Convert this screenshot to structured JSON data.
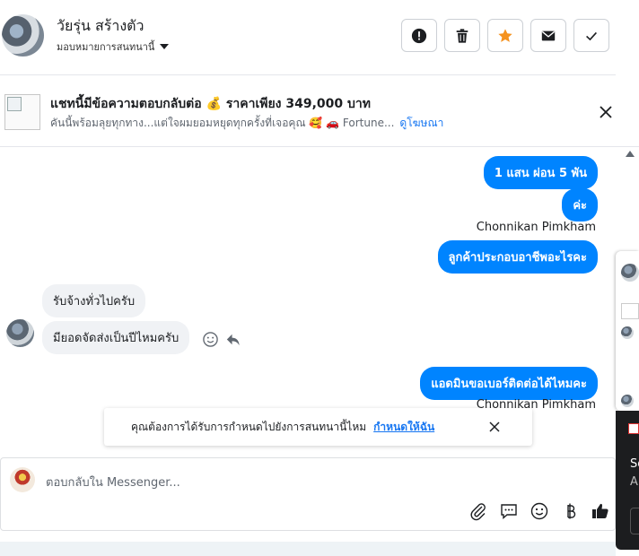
{
  "header": {
    "contact_name": "วัยรุ่น สร้างตัว",
    "assign_label": "มอบหมายการสนทนานี้",
    "actions": [
      "report-icon",
      "trash-icon",
      "star-icon",
      "envelope-icon",
      "check-icon"
    ]
  },
  "ad": {
    "title": "แชทนี้มีข้อความตอบกลับต่อ 💰 ราคาเพียง 349,000 บาท",
    "subtitle": "คันนี้พร้อมลุยทุกทาง...แต่ใจผมยอมหยุดทุกครั้งที่เจอคุณ 🥰 🚗 Fortune...",
    "link": "ดูโฆษณา"
  },
  "conversation": {
    "messages": [
      {
        "dir": "out",
        "text": "1 แสน ผ่อน 5 พัน"
      },
      {
        "dir": "out",
        "text": "ค่ะ"
      },
      {
        "dir": "sender",
        "text": "Chonnikan Pimkham"
      },
      {
        "dir": "out",
        "text": "ลูกค้าประกอบอาชีพอะไรคะ"
      },
      {
        "dir": "in",
        "text": "รับจ้างทั่วไปครับ"
      },
      {
        "dir": "in",
        "text": "มียอดจัดส่งเป็นปีไหมครับ"
      },
      {
        "dir": "out",
        "text": "แอดมินขอเบอร์ติดต่อได้ไหมคะ"
      },
      {
        "dir": "sender",
        "text": "Chonnikan Pimkham"
      }
    ]
  },
  "toast": {
    "text": "คุณต้องการได้รับการกำหนดไปยังการสนทนานี้ไหม",
    "link": "กำหนดให้ฉัน"
  },
  "composer": {
    "placeholder": "ตอบกลับใน Messenger...",
    "tools": [
      "paperclip-icon",
      "chat-bubble-icon",
      "emoji-icon",
      "baht-icon",
      "thumbs-up-icon"
    ]
  },
  "side_overlay": {
    "line1": "So",
    "line2": "A"
  },
  "colors": {
    "outgoing": "#0084ff",
    "incoming": "#f0f2f5",
    "link": "#1877f2",
    "star": "#f5921e"
  }
}
